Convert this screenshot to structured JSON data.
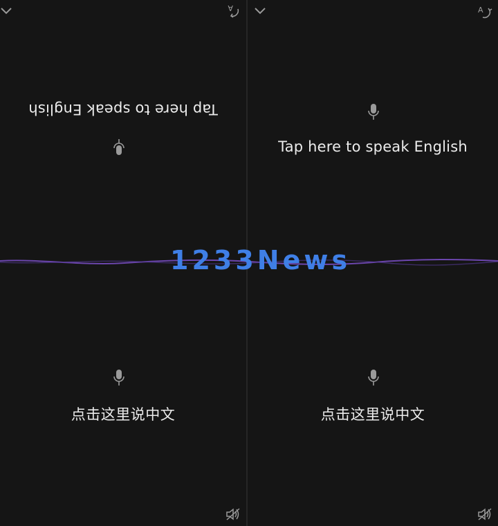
{
  "colors": {
    "background": "#151515",
    "text": "#ececec",
    "icon": "#9a9a9a",
    "wave": "#7b4fc9",
    "watermark": "#3f7fe6"
  },
  "left_panel": {
    "top_prompt": "Tap here to speak English",
    "top_prompt_orientation": "upside-down",
    "bottom_prompt": "点击这里说中文",
    "icons": [
      "chevron-down-icon",
      "translate-icon",
      "microphone-icon",
      "speaker-muted-icon"
    ]
  },
  "right_panel": {
    "top_prompt": "Tap here to speak English",
    "bottom_prompt": "点击这里说中文",
    "icons": [
      "chevron-down-icon",
      "translate-icon",
      "microphone-icon",
      "speaker-muted-icon"
    ]
  },
  "watermark": {
    "text": "1233News"
  }
}
